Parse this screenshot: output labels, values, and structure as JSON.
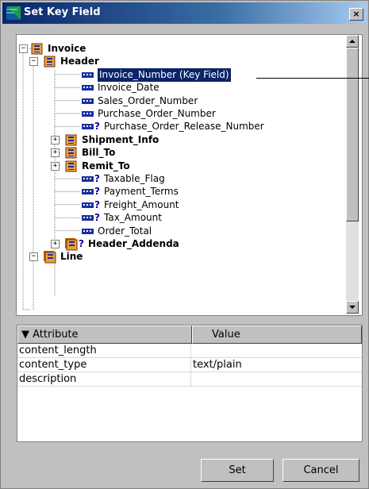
{
  "window": {
    "title": "Set Key Field",
    "close_label": "×"
  },
  "tree": {
    "nodes": [
      {
        "id": "invoice",
        "label": "Invoice",
        "bold": true,
        "type": "record",
        "optional": false,
        "expander": "−"
      },
      {
        "id": "header",
        "label": "Header",
        "bold": true,
        "type": "record",
        "optional": false,
        "expander": "−"
      },
      {
        "id": "invoice_number",
        "label": "Invoice_Number   (Key Field)",
        "bold": false,
        "type": "field",
        "optional": false,
        "selected": true
      },
      {
        "id": "invoice_date",
        "label": "Invoice_Date",
        "bold": false,
        "type": "field",
        "optional": false
      },
      {
        "id": "sales_order_number",
        "label": "Sales_Order_Number",
        "bold": false,
        "type": "field",
        "optional": false
      },
      {
        "id": "purchase_order_number",
        "label": "Purchase_Order_Number",
        "bold": false,
        "type": "field",
        "optional": false
      },
      {
        "id": "purchase_order_release_number",
        "label": "Purchase_Order_Release_Number",
        "bold": false,
        "type": "field",
        "optional": true
      },
      {
        "id": "shipment_info",
        "label": "Shipment_Info",
        "bold": true,
        "type": "record",
        "optional": false,
        "expander": "+"
      },
      {
        "id": "bill_to",
        "label": "Bill_To",
        "bold": true,
        "type": "record",
        "optional": false,
        "expander": "+"
      },
      {
        "id": "remit_to",
        "label": "Remit_To",
        "bold": true,
        "type": "record",
        "optional": false,
        "expander": "+"
      },
      {
        "id": "taxable_flag",
        "label": "Taxable_Flag",
        "bold": false,
        "type": "field",
        "optional": true
      },
      {
        "id": "payment_terms",
        "label": "Payment_Terms",
        "bold": false,
        "type": "field",
        "optional": true
      },
      {
        "id": "freight_amount",
        "label": "Freight_Amount",
        "bold": false,
        "type": "field",
        "optional": true
      },
      {
        "id": "tax_amount",
        "label": "Tax_Amount",
        "bold": false,
        "type": "field",
        "optional": true
      },
      {
        "id": "order_total",
        "label": "Order_Total",
        "bold": false,
        "type": "field",
        "optional": false
      },
      {
        "id": "header_addenda",
        "label": "Header_Addenda",
        "bold": true,
        "type": "repeating-record",
        "optional": true,
        "expander": "+"
      },
      {
        "id": "line",
        "label": "Line",
        "bold": true,
        "type": "repeating-record",
        "optional": false,
        "expander": "−"
      }
    ],
    "optional_marker": "?"
  },
  "attributes": {
    "headers": {
      "attribute": "▼ Attribute",
      "value": "Value"
    },
    "rows": [
      {
        "attribute": "content_length",
        "value": ""
      },
      {
        "attribute": "content_type",
        "value": "text/plain"
      },
      {
        "attribute": "description",
        "value": ""
      }
    ]
  },
  "buttons": {
    "set": "Set",
    "cancel": "Cancel"
  },
  "colors": {
    "selection": "#0a246a",
    "window_bg": "#c0c0c0",
    "record_icon": "#c05800",
    "field_icon": "#1a2fa0"
  }
}
